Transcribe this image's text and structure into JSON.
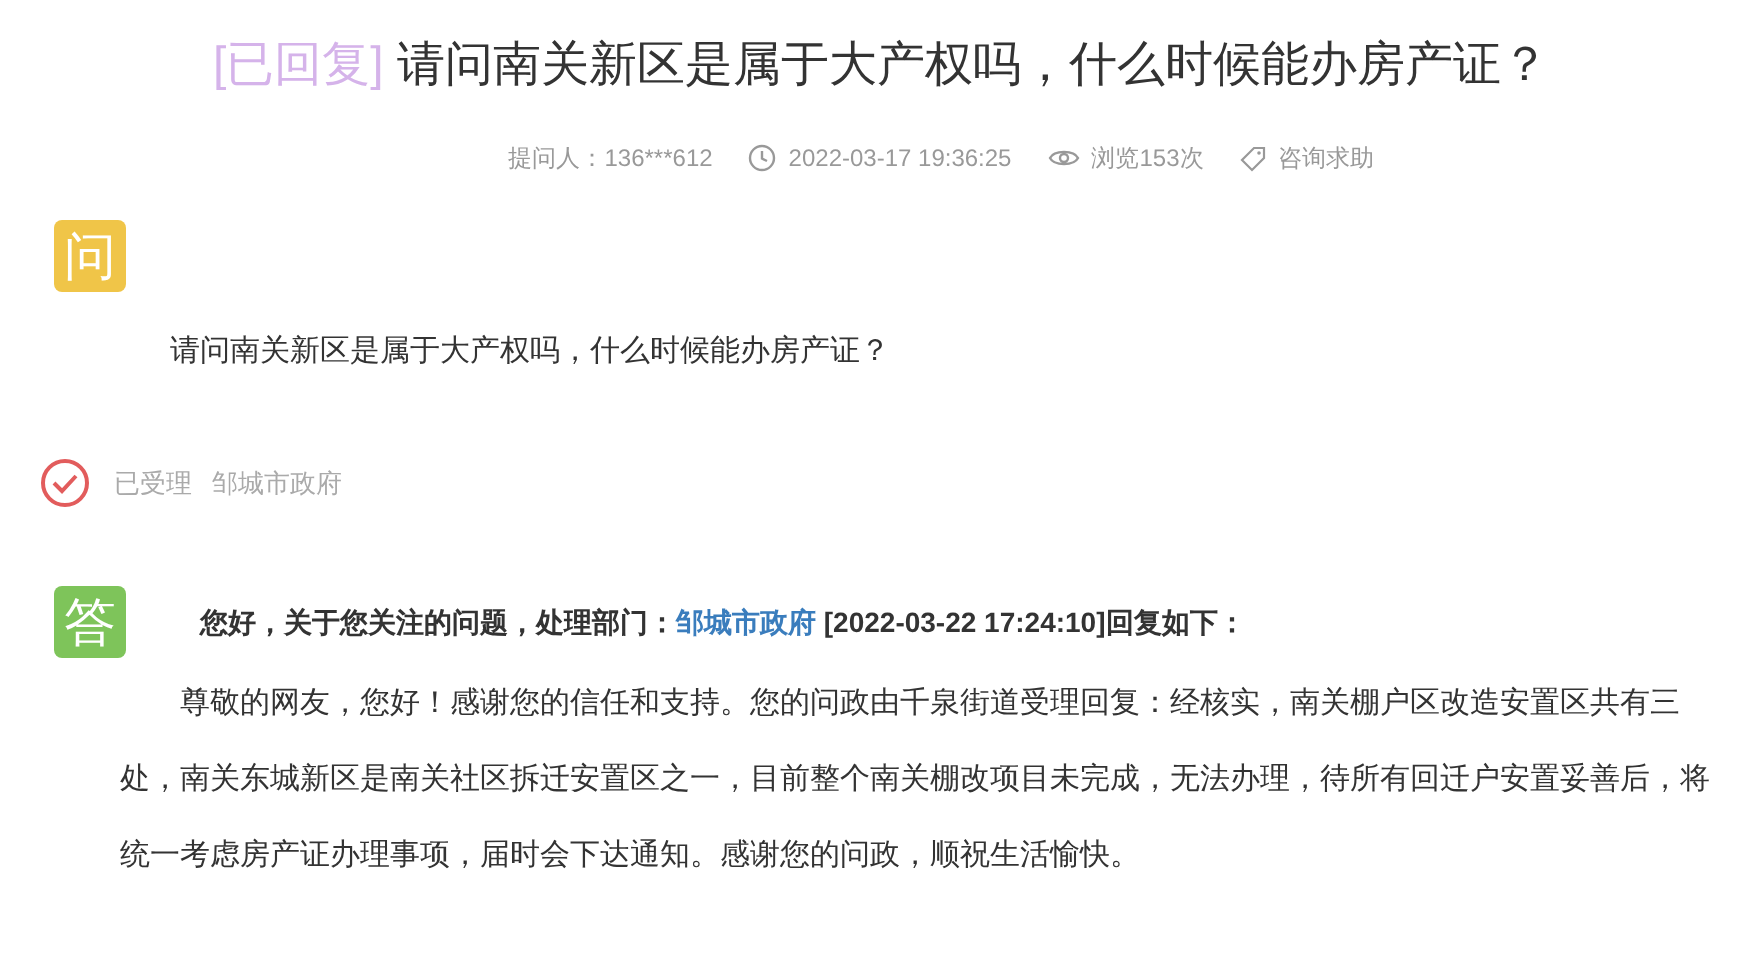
{
  "title": {
    "status": "[已回复]",
    "text": "请问南关新区是属于大产权吗，什么时候能办房产证？"
  },
  "meta": {
    "asker": "提问人：136***612",
    "time": "2022-03-17 19:36:25",
    "views": "浏览153次",
    "category": "咨询求助"
  },
  "question": {
    "badge": "问",
    "text": "请问南关新区是属于大产权吗，什么时候能办房产证？"
  },
  "status": {
    "label": "已受理",
    "department": "邹城市政府"
  },
  "answer": {
    "badge": "答",
    "header_prefix": "您好，关于您关注的问题，处理部门：",
    "header_link": "邹城市政府",
    "header_suffix": " [2022-03-22 17:24:10]回复如下：",
    "body": "尊敬的网友，您好！感谢您的信任和支持。您的问政由千泉街道受理回复：经核实，南关棚户区改造安置区共有三处，南关东城新区是南关社区拆迁安置区之一，目前整个南关棚改项目未完成，无法办理，待所有回迁户安置妥善后，将统一考虑房产证办理事项，届时会下达通知。感谢您的问政，顺祝生活愉快。"
  }
}
